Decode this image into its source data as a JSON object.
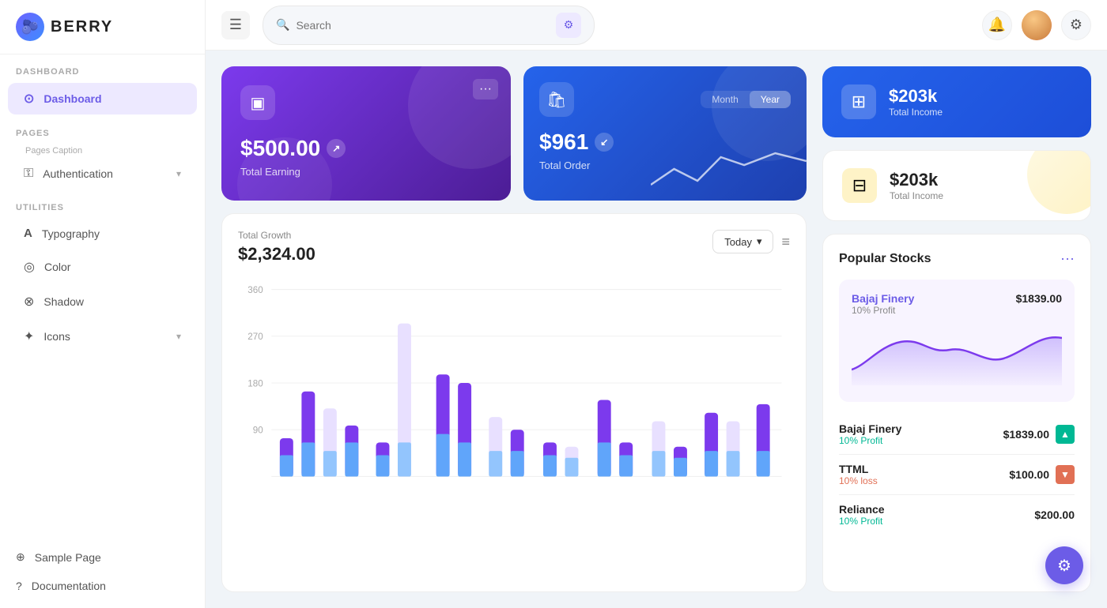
{
  "app": {
    "name": "BERRY",
    "logo_emoji": "🫐"
  },
  "header": {
    "search_placeholder": "Search",
    "menu_icon": "☰",
    "bell_icon": "🔔",
    "settings_icon": "⚙",
    "filter_icon": "⚙"
  },
  "sidebar": {
    "sections": [
      {
        "label": "Dashboard",
        "items": [
          {
            "id": "dashboard",
            "label": "Dashboard",
            "icon": "⊙",
            "active": true
          }
        ]
      },
      {
        "label": "Pages",
        "sublabel": "Pages Caption",
        "items": [
          {
            "id": "authentication",
            "label": "Authentication",
            "icon": "⚿",
            "has_chevron": true
          }
        ]
      },
      {
        "label": "Utilities",
        "items": [
          {
            "id": "typography",
            "label": "Typography",
            "icon": "A"
          },
          {
            "id": "color",
            "label": "Color",
            "icon": "◎"
          },
          {
            "id": "shadow",
            "label": "Shadow",
            "icon": "⊗"
          },
          {
            "id": "icons",
            "label": "Icons",
            "icon": "✦",
            "has_chevron": true
          }
        ]
      }
    ],
    "bottom_items": [
      {
        "id": "sample-page",
        "label": "Sample Page",
        "icon": "⊕"
      },
      {
        "id": "documentation",
        "label": "Documentation",
        "icon": "?"
      }
    ]
  },
  "cards": {
    "earning": {
      "amount": "$500.00",
      "label": "Total Earning",
      "icon": "▣",
      "more": "···"
    },
    "order": {
      "amount": "$961",
      "label": "Total Order",
      "icon": "🛍",
      "toggle": [
        "Month",
        "Year"
      ],
      "active_toggle": "Year"
    },
    "income_top": {
      "amount": "$203k",
      "label": "Total Income",
      "icon": "⊞"
    },
    "income_bottom": {
      "amount": "$203k",
      "label": "Total Income",
      "icon": "⊟"
    }
  },
  "growth": {
    "label": "Total Growth",
    "amount": "$2,324.00",
    "button_label": "Today",
    "y_labels": [
      "360",
      "270",
      "180",
      "90"
    ],
    "more_icon": "≡"
  },
  "stocks": {
    "title": "Popular Stocks",
    "featured": {
      "name": "Bajaj Finery",
      "price": "$1839.00",
      "profit_label": "10% Profit"
    },
    "list": [
      {
        "name": "Bajaj Finery",
        "profit": "10% Profit",
        "profit_type": "up",
        "price": "$1839.00"
      },
      {
        "name": "TTML",
        "profit": "10% loss",
        "profit_type": "down",
        "price": "$100.00"
      },
      {
        "name": "Reliance",
        "profit": "10% Profit",
        "profit_type": "up",
        "price": "$200.00"
      }
    ]
  },
  "fab": {
    "icon": "⚙"
  }
}
